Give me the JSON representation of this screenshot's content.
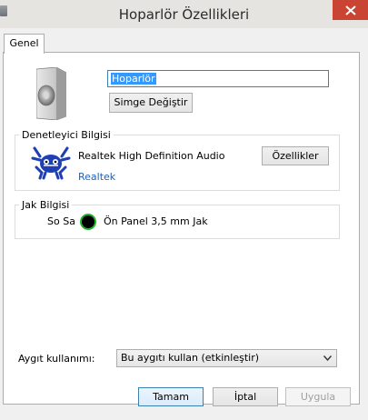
{
  "window": {
    "title": "Hoparlör Özellikleri"
  },
  "tabs": [
    {
      "label": "Genel"
    }
  ],
  "device": {
    "name": "Hoparlör",
    "change_icon_label": "Simge Değiştir"
  },
  "controller": {
    "group_label": "Denetleyici Bilgisi",
    "name": "Realtek High Definition Audio",
    "vendor_link": "Realtek",
    "properties_label": "Özellikler"
  },
  "jack": {
    "group_label": "Jak Bilgisi",
    "channel": "So Sa",
    "description": "Ön Panel 3,5 mm Jak",
    "status_color": "#1fb62b"
  },
  "usage": {
    "label": "Aygıt kullanımı:",
    "selected": "Bu aygıtı kullan (etkinleştir)"
  },
  "footer": {
    "ok": "Tamam",
    "cancel": "İptal",
    "apply": "Uygula"
  },
  "colors": {
    "close_button": "#c94433",
    "link": "#2260b8",
    "focus_border": "#3c7fb1"
  }
}
